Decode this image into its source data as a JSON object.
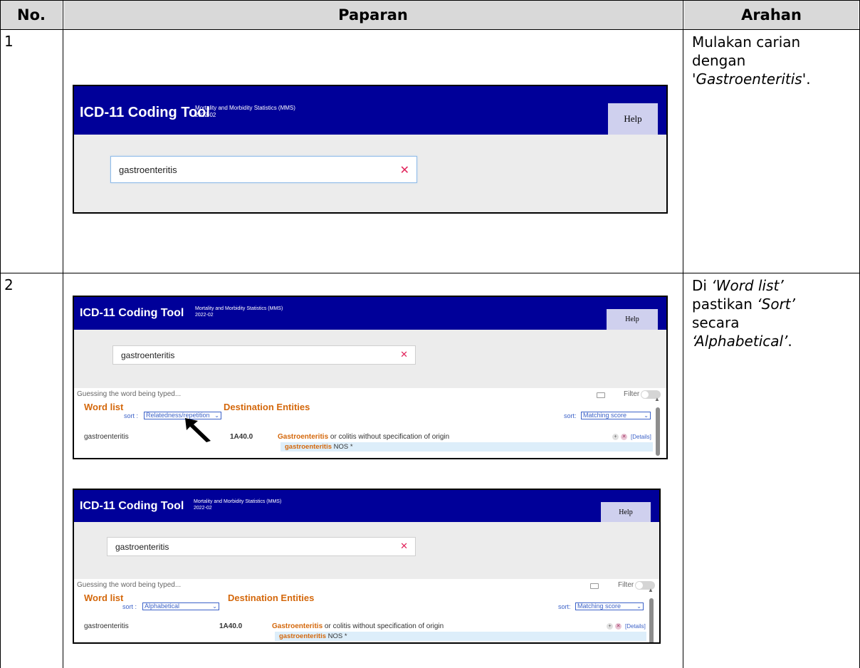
{
  "table": {
    "headers": {
      "no": "No.",
      "paparan": "Paparan",
      "arahan": "Arahan"
    },
    "rows": [
      {
        "no": "1",
        "arahan_plain": "Mulakan carian dengan ",
        "arahan_italic": "'Gastroenteritis'",
        "arahan_end": "."
      },
      {
        "no": "2",
        "arahan_1": "Di ",
        "arahan_italic_1": "‘Word list’",
        "arahan_2": "pastikan ",
        "arahan_italic_2": "‘Sort’",
        "arahan_3": "secara",
        "arahan_italic_3": "‘Alphabetical’",
        "arahan_end": "."
      }
    ]
  },
  "app": {
    "title": "ICD-11 Coding Tool",
    "subtitle_line1": "Mortality and Morbidity Statistics (MMS)",
    "subtitle_line2": "2022-02",
    "help_label": "Help",
    "search_value": "gastroenteritis",
    "clear_symbol": "✕",
    "guessing_text": "Guessing the word being typed...",
    "filter_label": "Filter",
    "word_list_heading": "Word list",
    "destination_heading": "Destination Entities",
    "sort_prefix": "sort :",
    "sort_prefix_right": "sort:",
    "sort_option_before": "Relatedness/repetition",
    "sort_option_after": "Alphabetical",
    "sort_right_option": "Matching score",
    "word_item": "gastroenteritis",
    "entity_code": "1A40.0",
    "entity_title_bold": "Gastroenteritis",
    "entity_title_rest": " or colitis without specification of origin",
    "entity_sub_bold": "gastroenteritis",
    "entity_sub_rest": " NOS  *",
    "details_label": "[Details]",
    "plus_symbol": "+",
    "x_symbol": "✕"
  }
}
